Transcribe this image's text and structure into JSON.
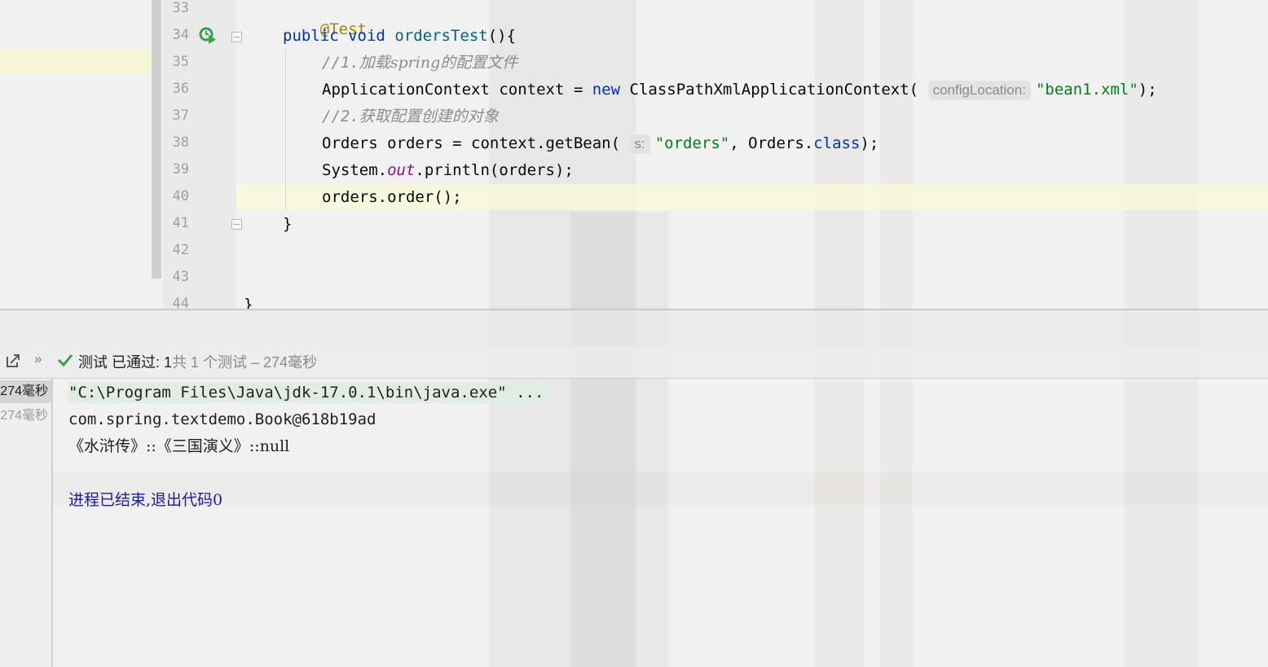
{
  "editor": {
    "line_numbers": [
      "33",
      "34",
      "35",
      "36",
      "37",
      "38",
      "39",
      "40",
      "41",
      "42",
      "43",
      "44"
    ],
    "lines": {
      "l33": {
        "annotation": "@Test"
      },
      "l34": {
        "kw_public": "public",
        "kw_void": "void",
        "method_name": "ordersTest",
        "rest": "(){"
      },
      "l35": {
        "comment_prefix": "//1.",
        "comment_text": "加载spring的配置文件"
      },
      "l36": {
        "type": "ApplicationContext context = ",
        "kw_new": "new",
        "ctor": " ClassPathXmlApplicationContext(",
        "hint": "configLocation:",
        "arg": "\"bean1.xml\"",
        "end": ");"
      },
      "l37": {
        "comment_prefix": "//2.",
        "comment_text": "获取配置创建的对象"
      },
      "l38": {
        "pre": "Orders orders = context.getBean(",
        "hint": "s:",
        "arg": "\"orders\"",
        "mid": ", Orders.",
        "kw_class": "class",
        "end": ");"
      },
      "l39": {
        "pre": "System.",
        "field": "out",
        "post": ".println(orders);"
      },
      "l40": {
        "text": "orders.order();"
      },
      "l41": {
        "text": "}"
      },
      "l44": {
        "text": "}"
      }
    }
  },
  "run_panel": {
    "toolbar": {
      "export_icon": "export-icon",
      "more_label": "»",
      "status_icon": "check-icon",
      "status_text": "测试 已通过: 1",
      "summary_text": "共 1 个测试 – 274毫秒"
    },
    "test_tree": [
      {
        "label": "274毫秒"
      },
      {
        "label": "274毫秒"
      }
    ],
    "console": {
      "command": "\"C:\\Program Files\\Java\\jdk-17.0.1\\bin\\java.exe\" ...",
      "line1": "com.spring.textdemo.Book@618b19ad",
      "line2": "《水浒传》::《三国演义》::null",
      "exit": "进程已结束,退出代码0"
    }
  },
  "colors": {
    "keyword": "#0033b3",
    "string": "#067d17",
    "annotation": "#9e880d",
    "comment": "#8c8c8c",
    "success": "#3f9f4f",
    "exit_text": "#1a1aa6"
  }
}
